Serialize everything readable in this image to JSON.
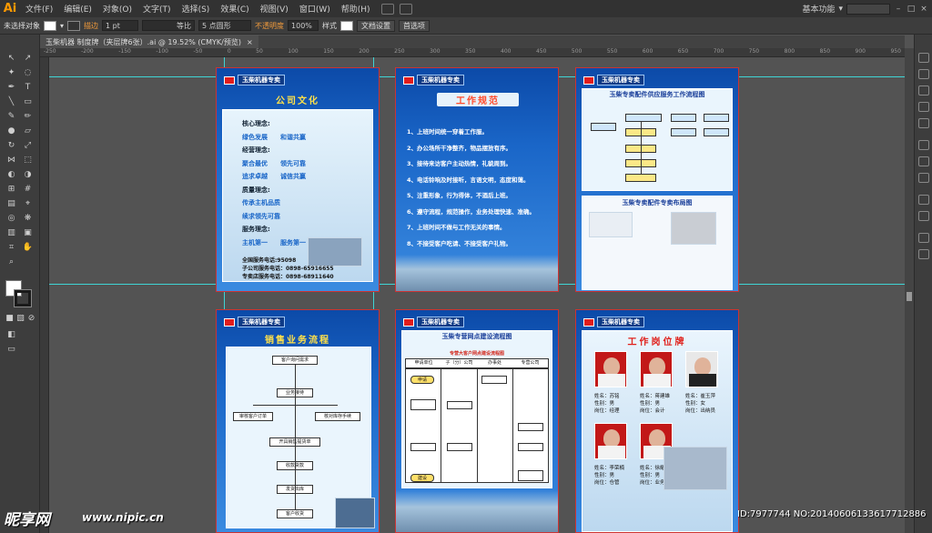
{
  "app": {
    "logo": "Ai",
    "menus": [
      "文件(F)",
      "编辑(E)",
      "对象(O)",
      "文字(T)",
      "选择(S)",
      "效果(C)",
      "视图(V)",
      "窗口(W)",
      "帮助(H)"
    ],
    "workspace": "基本功能",
    "window_controls": [
      "–",
      "□",
      "×"
    ]
  },
  "control": {
    "selection": "未选择对象",
    "stroke_label": "描边",
    "stroke_value": "1 pt",
    "profile": "等比",
    "brush": "5 点圆形",
    "opacity_label": "不透明度",
    "opacity_value": "100%",
    "style_label": "样式",
    "doc_setup": "文档设置",
    "prefs": "首选项"
  },
  "document": {
    "tab": "玉柴机器 制度牌（夹层牌6张）.ai @ 19.52% (CMYK/预览)",
    "close": "×"
  },
  "ruler": {
    "ticks": [
      "-250",
      "-200",
      "-150",
      "-100",
      "-50",
      "0",
      "50",
      "100",
      "150",
      "200",
      "250",
      "300",
      "350",
      "400",
      "450",
      "500",
      "550",
      "600",
      "650",
      "700",
      "750",
      "800",
      "850",
      "900",
      "950"
    ]
  },
  "posters": {
    "brand": "玉柴机器专卖",
    "culture": {
      "title": "公司文化",
      "lines": [
        "核心理念:",
        "绿色发展　　和谐共赢",
        "经营理念:",
        "聚合最优　　领先可靠",
        "追求卓越　　诚信共赢",
        "质量理念:",
        "传承主机品质",
        "续求领先可靠",
        "服务理念:",
        "主机第一　　服务第一"
      ],
      "hotline": [
        "全国服务电话:95098",
        "子公司服务电话：0898-65916655",
        "专卖店服务电话：0898-68911640"
      ]
    },
    "rules": {
      "title": "工作规范",
      "items": [
        "1、上班时间统一穿着工作服。",
        "2、办公场所干净整齐，物品摆放有序。",
        "3、接待来访客户主动热情，礼貌周到。",
        "4、电话铃响及时接听，言语文明，态度和蔼。",
        "5、注重形象，行为得体，不酒后上班。",
        "6、遵守流程，规范操作，业务处理快速、准确。",
        "7、上班时间不做与工作无关的事情。",
        "8、不接受客户吃请、不接受客户礼物。"
      ]
    },
    "process": {
      "title": "玉柴专卖配件供应服务工作流程图",
      "sub": "玉柴专卖配件专卖布局图"
    },
    "sales": {
      "title": "销售业务流程",
      "steps": [
        "客户询问需求",
        "业务接待",
        "审核客户订单",
        "核对库存手续",
        "开具销售提货单",
        "收款货款",
        "发货出库",
        "客户收货"
      ]
    },
    "network": {
      "title": "玉柴专营网点建设流程图",
      "sub": "专营大客户网点建设流程图",
      "cols": [
        "申请单位",
        "子（分）公司",
        "办事处",
        "专营公司"
      ],
      "start": "申请",
      "end": "建设"
    },
    "staff": {
      "title": "工作岗位牌",
      "people": [
        {
          "name": "姓名：苏铭",
          "gender": "性别：男",
          "post": "岗位：经理"
        },
        {
          "name": "姓名：蒋建雄",
          "gender": "性别：男",
          "post": "岗位：会计"
        },
        {
          "name": "姓名：崔玉萍",
          "gender": "性别：女",
          "post": "岗位：出纳员"
        },
        {
          "name": "姓名：李荣楠",
          "gender": "性别：男",
          "post": "岗位：仓管"
        },
        {
          "name": "姓名：徐耀凤",
          "gender": "性别：男",
          "post": "岗位：业务员"
        }
      ]
    }
  },
  "watermark": {
    "logo": "昵享网",
    "url": "www.nipic.cn",
    "id": "ID:7977744 NO:20140606133617712886"
  }
}
